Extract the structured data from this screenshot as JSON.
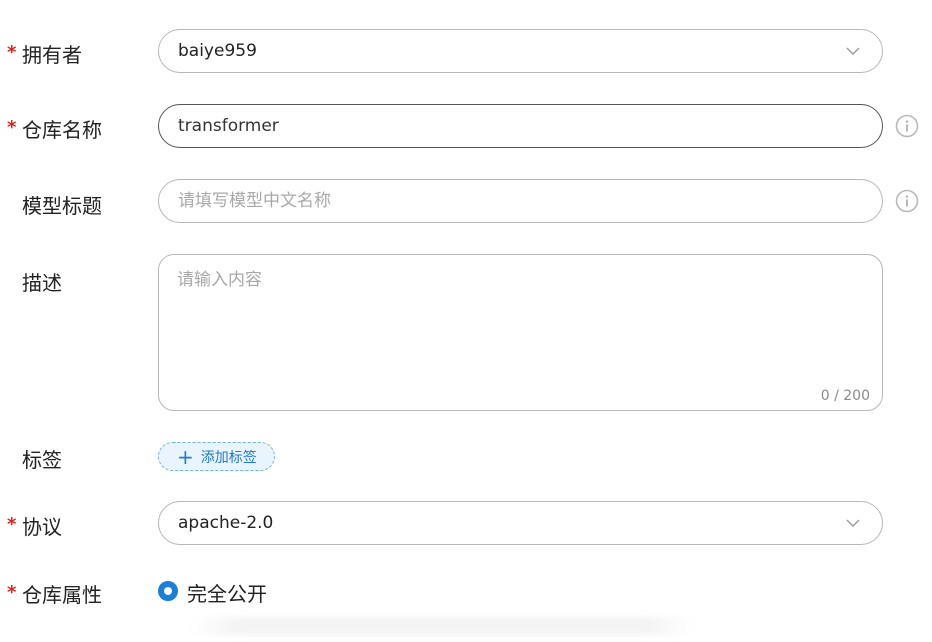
{
  "form": {
    "owner": {
      "label": "拥有者",
      "required_mark": "*",
      "value": "baiye959"
    },
    "repo_name": {
      "label": "仓库名称",
      "required_mark": "*",
      "value": "transformer"
    },
    "model_title": {
      "label": "模型标题",
      "placeholder": "请填写模型中文名称"
    },
    "description": {
      "label": "描述",
      "placeholder": "请输入内容",
      "counter": "0 / 200"
    },
    "tags": {
      "label": "标签",
      "add_button_plus": "+",
      "add_button_label": "添加标签"
    },
    "license": {
      "label": "协议",
      "required_mark": "*",
      "value": "apache-2.0"
    },
    "visibility": {
      "label": "仓库属性",
      "required_mark": "*",
      "selected_option": "完全公开"
    }
  },
  "icons": {
    "select_arrow": "chevron-down-icon",
    "info": "info-circle-icon",
    "radio": "radio-selected-icon"
  },
  "colors": {
    "required": "#e0201b",
    "accent": "#1a7fd6",
    "tag_bg": "#eaf4fd",
    "border": "#b7b7b7"
  }
}
